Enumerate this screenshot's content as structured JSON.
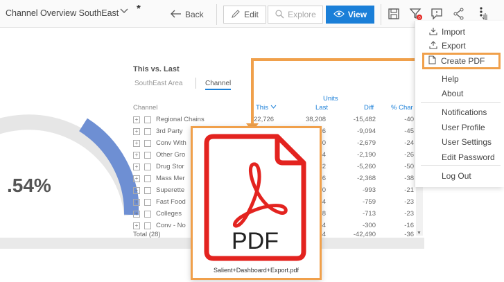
{
  "toolbar": {
    "title": "Channel Overview SouthEast",
    "back_label": "Back",
    "edit_label": "Edit",
    "explore_label": "Explore",
    "view_label": "View",
    "icons": [
      "save-icon",
      "filter-icon",
      "comment-icon",
      "share-icon",
      "more-icon"
    ],
    "accent_color": "#1a7fd8"
  },
  "dashboard": {
    "big_number": ".54%",
    "panel": {
      "title": "This vs. Last",
      "tabs": [
        "SouthEast Area",
        "Channel"
      ],
      "active_tab": "Channel",
      "column_header_group": "Units",
      "columns": [
        "Channel",
        "This",
        "Last",
        "Diff",
        "% Char"
      ],
      "rows": [
        {
          "name": "Regional Chains",
          "this": "22,726",
          "last": "38,208",
          "diff": "-15,482",
          "pct": "-40"
        },
        {
          "name": "3rd Party",
          "this": "",
          "last": "16",
          "diff": "-9,094",
          "pct": "-45"
        },
        {
          "name": "Conv With",
          "this": "",
          "last": "30",
          "diff": "-2,679",
          "pct": "-24"
        },
        {
          "name": "Other Gro",
          "this": "",
          "last": "54",
          "diff": "-2,190",
          "pct": "-26"
        },
        {
          "name": "Drug Stor",
          "this": "",
          "last": "32",
          "diff": "-5,260",
          "pct": "-50"
        },
        {
          "name": "Mass Mer",
          "this": "",
          "last": "76",
          "diff": "-2,368",
          "pct": "-38"
        },
        {
          "name": "Superette",
          "this": "",
          "last": "70",
          "diff": "-993",
          "pct": "-21"
        },
        {
          "name": "Fast Food",
          "this": "",
          "last": "54",
          "diff": "-759",
          "pct": "-23"
        },
        {
          "name": "Colleges",
          "this": "",
          "last": "78",
          "diff": "-713",
          "pct": "-23"
        },
        {
          "name": "Conv - No",
          "this": "",
          "last": "54",
          "diff": "-300",
          "pct": "-16"
        }
      ],
      "total_label": "Total (28)",
      "total_last": "34",
      "total_diff": "-42,490",
      "total_pct": "-36"
    }
  },
  "menu": {
    "items": [
      {
        "label": "Import",
        "icon": "import-icon"
      },
      {
        "label": "Export",
        "icon": "export-icon"
      },
      {
        "label": "Create PDF",
        "icon": "document-icon"
      },
      {
        "label": "Help"
      },
      {
        "label": "About"
      },
      {
        "label": "Notifications"
      },
      {
        "label": "User Profile"
      },
      {
        "label": "User Settings"
      },
      {
        "label": "Edit Password"
      },
      {
        "label": "Log Out"
      }
    ]
  },
  "callout": {
    "pdf_label": "PDF",
    "filename": "Salient+Dashboard+Export.pdf",
    "highlight_color": "#f0a04b",
    "pdf_red": "#e3231f"
  }
}
